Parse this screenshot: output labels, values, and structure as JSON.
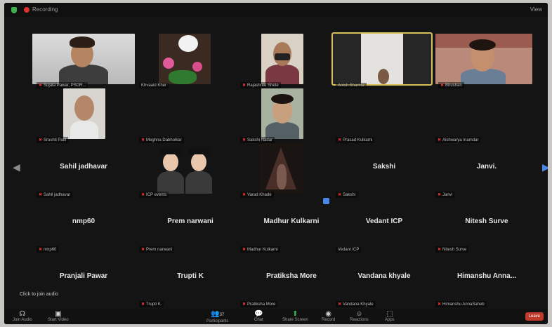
{
  "window": {
    "recording_label": "Recording",
    "view_label": "View"
  },
  "participants": [
    {
      "name": "Sujata Pawar, PSDR..."
    },
    {
      "name": "Khvaaid Kher"
    },
    {
      "name": "Rajashree Shete"
    },
    {
      "name": "Anish Sharma"
    },
    {
      "name": "Bhushan"
    },
    {
      "name": "Srushti Patil"
    },
    {
      "name": "Meghna Dabholkar"
    },
    {
      "name": "Sakshi Nadar"
    },
    {
      "name": "Prasad Kulkarni"
    },
    {
      "name": "Aishwarya Inamdar"
    },
    {
      "name": "Sahil jadhavar",
      "big_name": "Sahil jadhavar"
    },
    {
      "name": "ICP events"
    },
    {
      "name": "Varad Khade"
    },
    {
      "name": "Sakshi",
      "big_name": "Sakshi"
    },
    {
      "name": "Janvi",
      "big_name": "Janvi."
    },
    {
      "name": "nmp60",
      "big_name": "nmp60"
    },
    {
      "name": "Prem narwani",
      "big_name": "Prem narwani"
    },
    {
      "name": "Madhur Kulkarni",
      "big_name": "Madhur Kulkarni"
    },
    {
      "name": "Vedant ICP",
      "big_name": "Vedant ICP"
    },
    {
      "name": "Nitesh Surve",
      "big_name": "Nitesh Surve"
    },
    {
      "name": "Trupti K.",
      "big_name": "Trupti K"
    },
    {
      "name": "Pratiksha More",
      "big_name": "Pratiksha More"
    },
    {
      "name": "Vandana Khyale",
      "big_name": "Vandana khyale"
    },
    {
      "name": "Himanshu AnnaSaheb",
      "big_name": "Himanshu  Anna..."
    },
    {
      "big_name": "Pranjali Pawar"
    }
  ],
  "join_audio_hint": "Click to join audio",
  "toolbar": {
    "join_audio": "Join Audio",
    "start_video": "Start Video",
    "participants": "Participants",
    "participants_count": "37",
    "chat": "Chat",
    "share_screen": "Share Screen",
    "record": "Record",
    "reactions": "Reactions",
    "apps": "Apps",
    "leave": "Leave"
  },
  "colors": {
    "active_speaker": "#d8c05a",
    "accent": "#4a86e8",
    "leave": "#c0392b"
  }
}
